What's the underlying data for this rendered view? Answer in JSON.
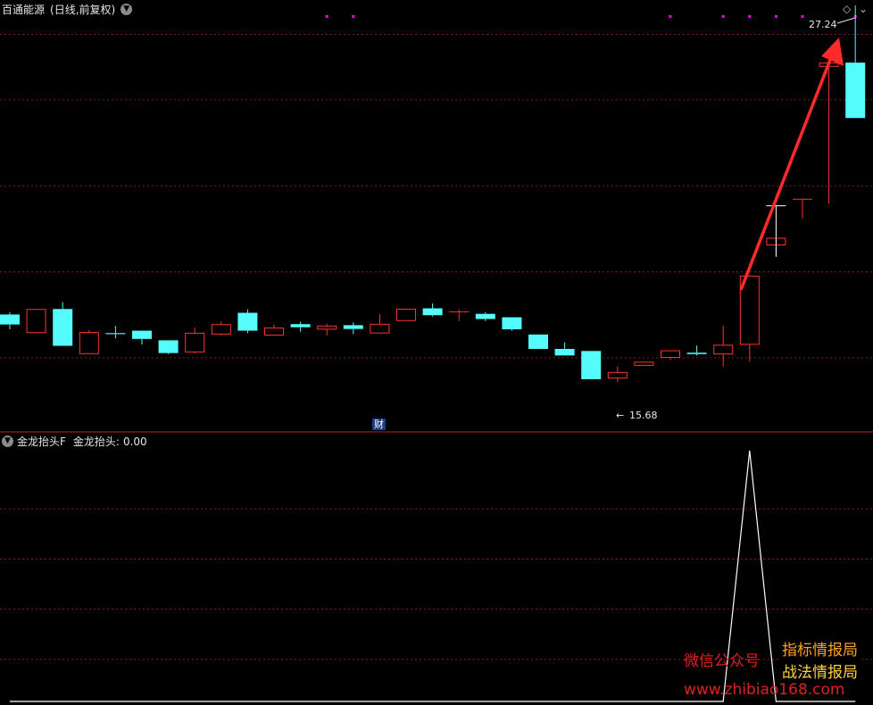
{
  "header": {
    "title": "百通能源",
    "period": "(日线,前复权)"
  },
  "indicator": {
    "name": "金龙抬头F",
    "label": "金龙抬头:",
    "value": "0.00"
  },
  "badge": {
    "cai": "财"
  },
  "annotations": {
    "high": "27.24",
    "low": "15.68"
  },
  "watermark": {
    "line1_left": "微信公众号",
    "line1_right": "指标情报局",
    "line2": "战法情报局",
    "url": "www.zhibiao168.com"
  },
  "colors": {
    "up": "#ff3232",
    "down": "#54fcfc",
    "grid": "#8b1a1a",
    "divider": "#b22222",
    "arrow": "#ff2a2a",
    "signal_line": "#ffffff",
    "marker": "#ff00ff"
  },
  "chart_data": [
    {
      "type": "candlestick",
      "title": "百通能源 (日线,前复权)",
      "ylim": [
        14.9,
        27.4
      ],
      "gridlines": [
        17.0,
        19.5,
        22.0,
        24.5,
        26.4
      ],
      "candles": [
        {
          "o": 18.26,
          "h": 18.33,
          "l": 17.83,
          "c": 17.97
        },
        {
          "o": 17.72,
          "h": 18.42,
          "l": 17.72,
          "c": 18.42
        },
        {
          "o": 18.42,
          "h": 18.62,
          "l": 17.35,
          "c": 17.35
        },
        {
          "o": 17.11,
          "h": 17.81,
          "l": 17.11,
          "c": 17.75
        },
        {
          "o": 17.72,
          "h": 17.93,
          "l": 17.57,
          "c": 17.69
        },
        {
          "o": 17.79,
          "h": 17.79,
          "l": 17.39,
          "c": 17.55
        },
        {
          "o": 17.51,
          "h": 17.51,
          "l": 17.11,
          "c": 17.14
        },
        {
          "o": 17.16,
          "h": 17.88,
          "l": 17.13,
          "c": 17.73
        },
        {
          "o": 17.68,
          "h": 18.06,
          "l": 17.65,
          "c": 17.98
        },
        {
          "o": 18.31,
          "h": 18.41,
          "l": 17.72,
          "c": 17.79
        },
        {
          "o": 17.65,
          "h": 17.96,
          "l": 17.65,
          "c": 17.88
        },
        {
          "o": 17.98,
          "h": 18.05,
          "l": 17.76,
          "c": 17.89
        },
        {
          "o": 17.82,
          "h": 17.99,
          "l": 17.65,
          "c": 17.94
        },
        {
          "o": 17.95,
          "h": 18.03,
          "l": 17.69,
          "c": 17.84
        },
        {
          "o": 17.71,
          "h": 18.27,
          "l": 17.71,
          "c": 17.99
        },
        {
          "o": 18.07,
          "h": 18.43,
          "l": 18.07,
          "c": 18.43
        },
        {
          "o": 18.44,
          "h": 18.58,
          "l": 18.2,
          "c": 18.24
        },
        {
          "o": 18.34,
          "h": 18.41,
          "l": 18.07,
          "c": 18.34
        },
        {
          "o": 18.28,
          "h": 18.33,
          "l": 18.07,
          "c": 18.13
        },
        {
          "o": 18.18,
          "h": 18.18,
          "l": 17.79,
          "c": 17.83
        },
        {
          "o": 17.68,
          "h": 17.68,
          "l": 17.26,
          "c": 17.26
        },
        {
          "o": 17.26,
          "h": 17.45,
          "l": 17.07,
          "c": 17.07
        },
        {
          "o": 17.2,
          "h": 17.2,
          "l": 16.38,
          "c": 16.38
        },
        {
          "o": 16.4,
          "h": 16.75,
          "l": 16.3,
          "c": 16.59
        },
        {
          "o": 16.77,
          "h": 16.89,
          "l": 16.77,
          "c": 16.89
        },
        {
          "o": 17.0,
          "h": 17.22,
          "l": 16.94,
          "c": 17.22
        },
        {
          "o": 17.15,
          "h": 17.36,
          "l": 17.07,
          "c": 17.11
        },
        {
          "o": 17.1,
          "h": 17.93,
          "l": 16.75,
          "c": 17.38
        },
        {
          "o": 17.38,
          "h": 19.39,
          "l": 16.89,
          "c": 19.39
        },
        {
          "o": 20.27,
          "h": 20.27,
          "l": 19.94,
          "c": 20.49
        },
        {
          "o": 21.61,
          "h": 21.61,
          "l": 21.05,
          "c": 21.61
        },
        {
          "o": 25.46,
          "h": 25.46,
          "l": 21.48,
          "c": 25.58
        },
        {
          "o": 25.58,
          "h": 27.24,
          "l": 23.97,
          "c": 23.97
        }
      ],
      "markers": [
        12,
        13,
        25,
        27,
        28,
        29,
        30,
        32
      ]
    },
    {
      "type": "line",
      "title": "金龙抬头F",
      "series": [
        {
          "name": "金龙抬头",
          "values": [
            0,
            0,
            0,
            0,
            0,
            0,
            0,
            0,
            0,
            0,
            0,
            0,
            0,
            0,
            0,
            0,
            0,
            0,
            0,
            0,
            0,
            0,
            0,
            0,
            0,
            0,
            0,
            0,
            1,
            0,
            0,
            0,
            0
          ]
        }
      ],
      "ylim": [
        0,
        1
      ]
    }
  ]
}
